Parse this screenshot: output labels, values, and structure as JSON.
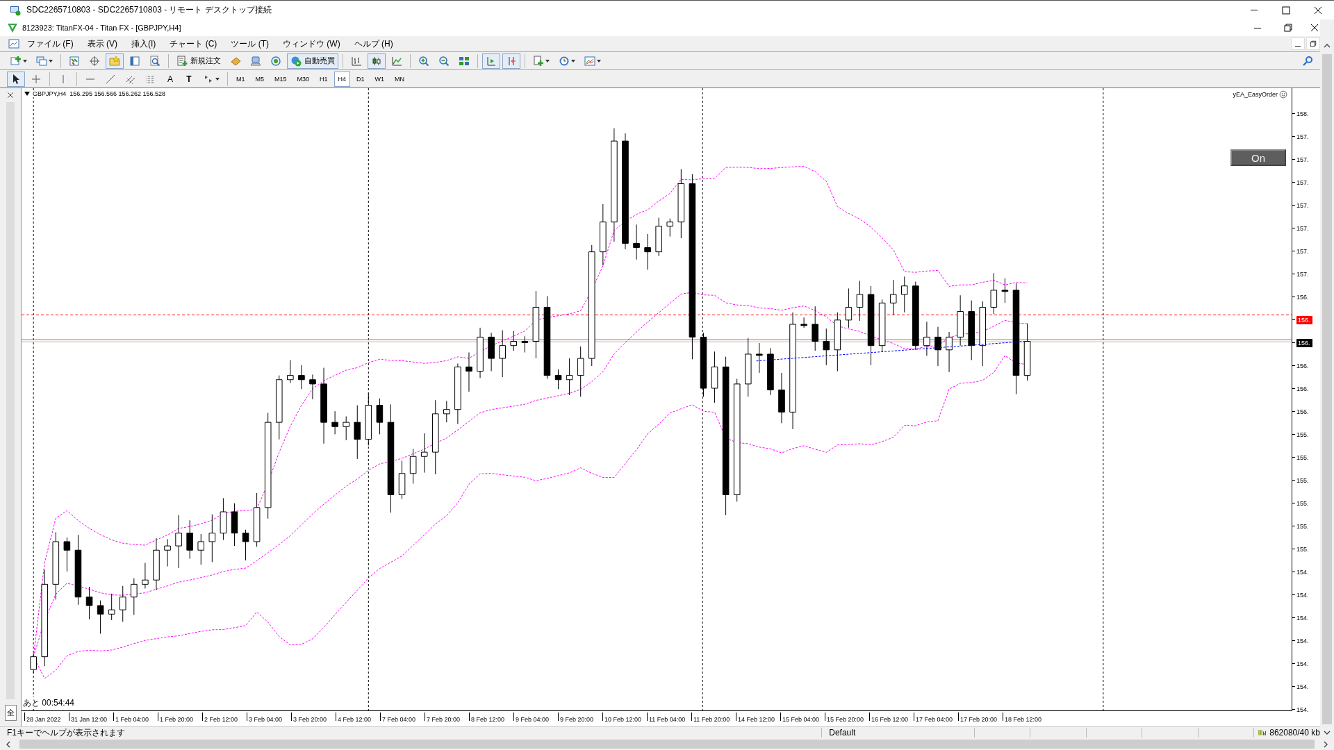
{
  "remote_window": {
    "title": "SDC2265710803 - SDC2265710803 - リモート デスクトップ接続"
  },
  "app_window": {
    "title": "8123923: TitanFX-04 - Titan FX - [GBPJPY,H4]"
  },
  "menu": [
    "ファイル (F)",
    "表示 (V)",
    "挿入(I)",
    "チャート (C)",
    "ツール (T)",
    "ウィンドウ (W)",
    "ヘルプ (H)"
  ],
  "toolbar": {
    "new_order": "新規注文",
    "autotrading": {
      "label": "自動売買",
      "on": true
    },
    "favorites_on": true,
    "candlesticks_on": true,
    "chart_shift_on": true,
    "auto_scroll_on": true
  },
  "drawing_toolbar": {
    "cursor_on": true,
    "text_tool": "A",
    "text_label_tool": "T"
  },
  "timeframes": [
    {
      "label": "M1",
      "selected": false
    },
    {
      "label": "M5",
      "selected": false
    },
    {
      "label": "M15",
      "selected": false
    },
    {
      "label": "M30",
      "selected": false
    },
    {
      "label": "H1",
      "selected": false
    },
    {
      "label": "H4",
      "selected": true
    },
    {
      "label": "D1",
      "selected": false
    },
    {
      "label": "W1",
      "selected": false
    },
    {
      "label": "MN",
      "selected": false
    }
  ],
  "navigator_panel": {
    "tab": "全"
  },
  "chart": {
    "header": "GBPJPY,H4  156.295 156.566 156.262 156.528",
    "expert": "yEA_EasyOrder",
    "ea_button": "On",
    "countdown": "あと 00:54:44",
    "price_axis": [
      {
        "label": "158.",
        "kind": "tick"
      },
      {
        "label": "157.",
        "kind": "tick"
      },
      {
        "label": "157.",
        "kind": "tick"
      },
      {
        "label": "157.",
        "kind": "tick"
      },
      {
        "label": "157.",
        "kind": "tick"
      },
      {
        "label": "157.",
        "kind": "tick"
      },
      {
        "label": "157.",
        "kind": "tick"
      },
      {
        "label": "157.",
        "kind": "tick"
      },
      {
        "label": "156.",
        "kind": "tick"
      },
      {
        "label": "156.",
        "kind": "line-tag"
      },
      {
        "label": "156.",
        "kind": "bid-tag"
      },
      {
        "label": "156.",
        "kind": "tick"
      },
      {
        "label": "156.",
        "kind": "tick"
      },
      {
        "label": "156.",
        "kind": "tick"
      },
      {
        "label": "155.",
        "kind": "tick"
      },
      {
        "label": "155.",
        "kind": "tick"
      },
      {
        "label": "155.",
        "kind": "tick"
      },
      {
        "label": "155.",
        "kind": "tick"
      },
      {
        "label": "155.",
        "kind": "tick"
      },
      {
        "label": "155.",
        "kind": "tick"
      },
      {
        "label": "154.",
        "kind": "tick"
      },
      {
        "label": "154.",
        "kind": "tick"
      },
      {
        "label": "154.",
        "kind": "tick"
      },
      {
        "label": "154.",
        "kind": "tick"
      },
      {
        "label": "154.",
        "kind": "tick"
      },
      {
        "label": "154.",
        "kind": "tick"
      },
      {
        "label": "154.",
        "kind": "tick"
      }
    ],
    "time_axis": [
      "28 Jan 2022",
      "31 Jan 12:00",
      "1 Feb 04:00",
      "1 Feb 20:00",
      "2 Feb 12:00",
      "3 Feb 04:00",
      "3 Feb 20:00",
      "4 Feb 12:00",
      "7 Feb 04:00",
      "7 Feb 20:00",
      "8 Feb 12:00",
      "9 Feb 04:00",
      "9 Feb 20:00",
      "10 Feb 12:00",
      "11 Feb 04:00",
      "11 Feb 20:00",
      "14 Feb 12:00",
      "15 Feb 04:00",
      "15 Feb 20:00",
      "16 Feb 12:00",
      "17 Feb 04:00",
      "17 Feb 20:00",
      "18 Feb 12:00"
    ]
  },
  "status_bar": {
    "help": "F1キーでヘルプが表示されます",
    "profile": "Default",
    "traffic": "862080/40 kb"
  }
}
